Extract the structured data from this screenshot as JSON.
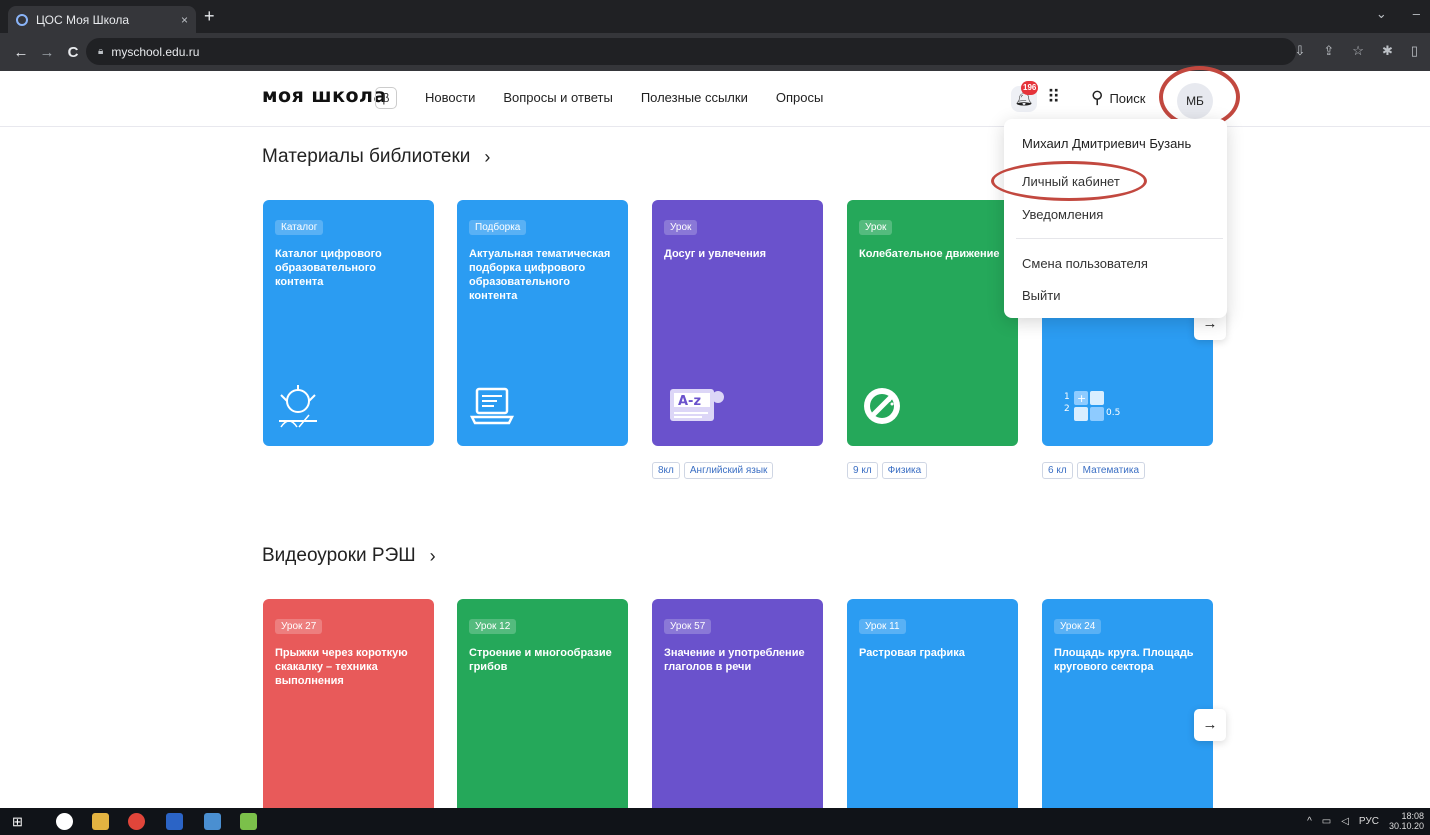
{
  "browser": {
    "tab_title": "ЦОС Моя Школа",
    "tab_close": "×",
    "new_tab": "+",
    "url": "myschool.edu.ru",
    "back": "←",
    "forward": "→",
    "reload": "C"
  },
  "header": {
    "logo": "моя школа",
    "beta": "β",
    "nav": [
      "Новости",
      "Вопросы и ответы",
      "Полезные ссылки",
      "Опросы"
    ],
    "notification_count": "196",
    "search_label": "Поиск",
    "avatar_initials": "МБ"
  },
  "user_menu": {
    "name": "Михаил Дмитриевич Бузань",
    "items": [
      "Личный кабинет",
      "Уведомления",
      "Смена пользователя",
      "Выйти"
    ]
  },
  "library": {
    "title": "Материалы библиотеки",
    "cards": [
      {
        "tag": "Каталог",
        "title": "Каталог цифрового образовательного контента",
        "icon": "academy-emblem-icon",
        "color": "#2b9cf2",
        "grade": "",
        "subject": ""
      },
      {
        "tag": "Подборка",
        "title": "Актуальная тематическая подборка цифрового образовательного контента",
        "icon": "laptop-icon",
        "color": "#2b9cf2",
        "grade": "",
        "subject": ""
      },
      {
        "tag": "Урок",
        "title": "Досуг и увлечения",
        "icon": "a-z-book-icon",
        "color": "#6a52cc",
        "grade": "8кл",
        "subject": "Английский язык"
      },
      {
        "tag": "Урок",
        "title": "Колебательное движение",
        "icon": "pendulum-icon",
        "color": "#25a85a",
        "grade": "9 кл",
        "subject": "Физика"
      },
      {
        "tag": "",
        "title": "",
        "icon": "math-blocks-icon",
        "color": "#2b9cf2",
        "grade": "6 кл",
        "subject": "Математика"
      }
    ],
    "next_arrow": "→"
  },
  "videos": {
    "title": "Видеоуроки РЭШ",
    "cards": [
      {
        "tag": "Урок 27",
        "title": "Прыжки через короткую скакалку – техника выполнения",
        "color": "#e85a5a"
      },
      {
        "tag": "Урок 12",
        "title": "Строение и многообразие грибов",
        "color": "#25a85a"
      },
      {
        "tag": "Урок 57",
        "title": "Значение и употребление глаголов в речи",
        "color": "#6a52cc"
      },
      {
        "tag": "Урок 11",
        "title": "Растровая графика",
        "color": "#2b9cf2"
      },
      {
        "tag": "Урок 24",
        "title": "Площадь круга. Площадь кругового сектора",
        "color": "#2b9cf2"
      }
    ],
    "next_arrow": "→"
  },
  "taskbar": {
    "lang": "РУС",
    "time": "18:08",
    "date": "30.10.20"
  }
}
